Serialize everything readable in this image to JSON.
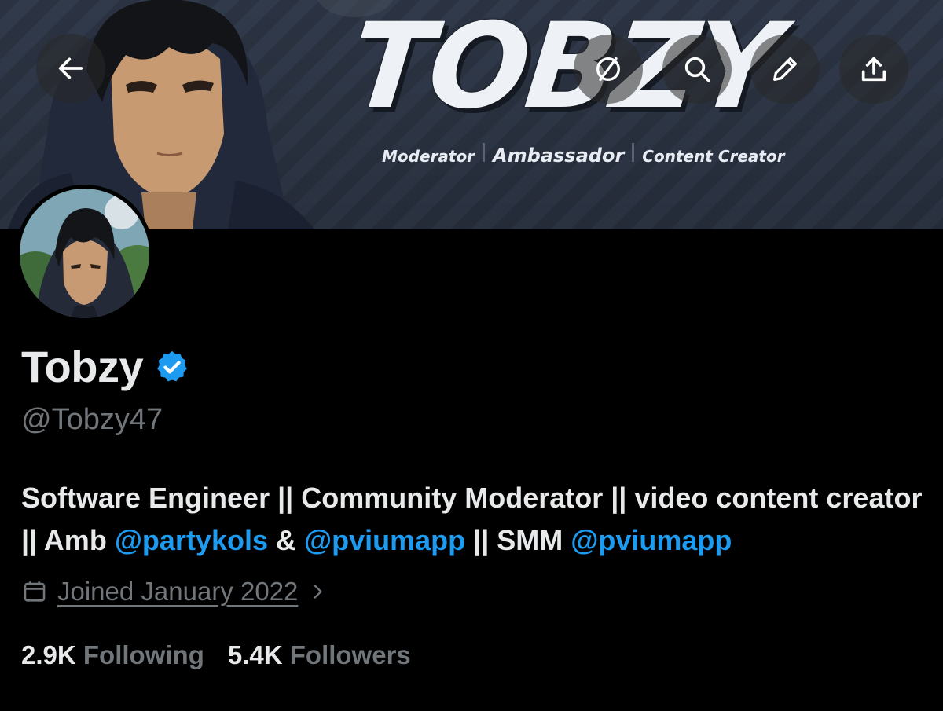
{
  "banner": {
    "title": "TOBZY",
    "roles": [
      "Moderator",
      "Ambassador",
      "Content Creator"
    ]
  },
  "toolbar": {
    "back_icon": "arrow-left-icon",
    "translate_icon": "translate-icon",
    "search_icon": "search-icon",
    "edit_icon": "pencil-icon",
    "share_icon": "share-icon"
  },
  "profile": {
    "display_name": "Tobzy",
    "handle": "@Tobzy47",
    "verified": true,
    "bio": {
      "part1": "Software Engineer || Community Moderator || video content creator || Amb ",
      "mention1": "@partykols",
      "part2": " & ",
      "mention2": "@pviumapp",
      "part3": " || SMM ",
      "mention3": "@pviumapp"
    },
    "joined": "Joined January 2022",
    "following_count": "2.9K",
    "following_label": "Following",
    "followers_count": "5.4K",
    "followers_label": "Followers"
  },
  "colors": {
    "background": "#000000",
    "text": "#e7e9ea",
    "muted": "#71767b",
    "accent": "#1d9bf0"
  }
}
